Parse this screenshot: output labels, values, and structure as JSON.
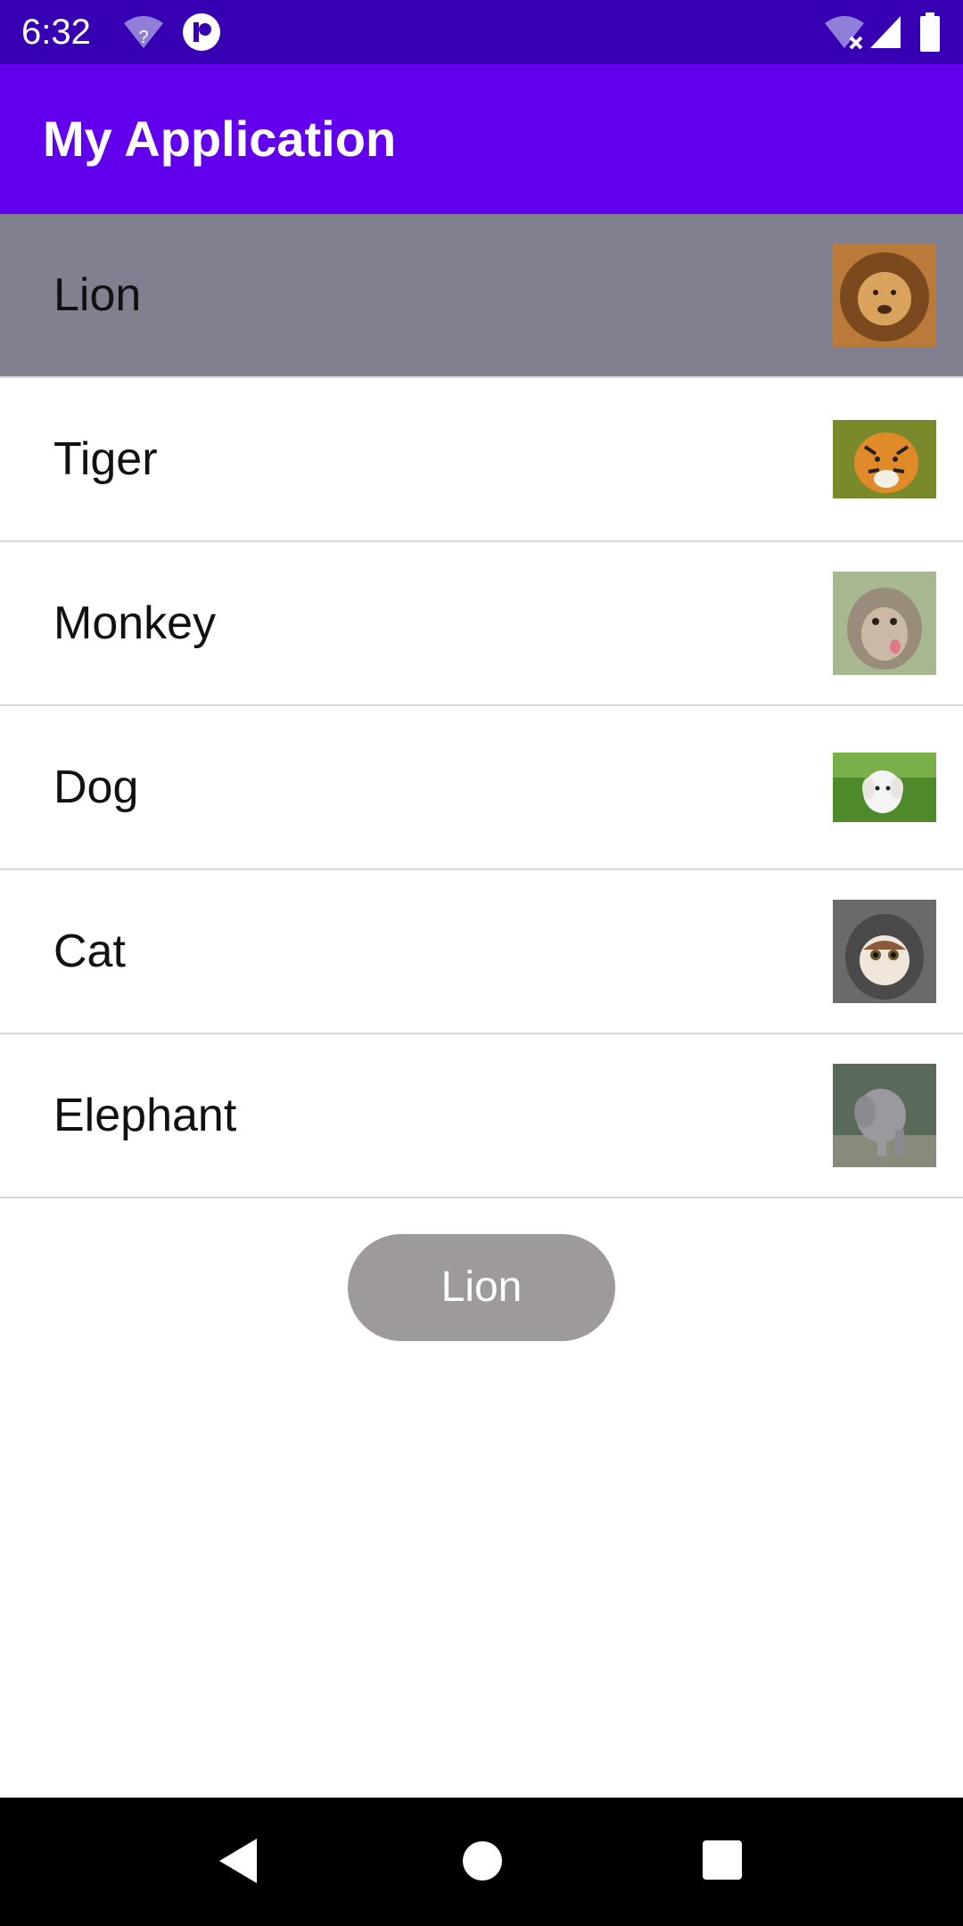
{
  "status_bar": {
    "time": "6:32",
    "icons_left": [
      "wifi-question-icon",
      "notification-app-icon"
    ],
    "icons_right": [
      "wifi-off-icon",
      "signal-icon",
      "battery-icon"
    ]
  },
  "app_bar": {
    "title": "My Application"
  },
  "list": {
    "items": [
      {
        "label": "Lion",
        "thumbnail": "lion-thumbnail",
        "selected": true
      },
      {
        "label": "Tiger",
        "thumbnail": "tiger-thumbnail",
        "selected": false
      },
      {
        "label": "Monkey",
        "thumbnail": "monkey-thumbnail",
        "selected": false
      },
      {
        "label": "Dog",
        "thumbnail": "dog-thumbnail",
        "selected": false
      },
      {
        "label": "Cat",
        "thumbnail": "cat-thumbnail",
        "selected": false
      },
      {
        "label": "Elephant",
        "thumbnail": "elephant-thumbnail",
        "selected": false
      }
    ]
  },
  "selected_button": {
    "label": "Lion"
  },
  "nav_bar": {
    "icons": [
      "back-icon",
      "home-icon",
      "recents-icon"
    ]
  },
  "colors": {
    "status_bar": "#3700b3",
    "app_bar": "#6200ee",
    "selected_row": "#808090",
    "button": "#9e9a9a"
  }
}
